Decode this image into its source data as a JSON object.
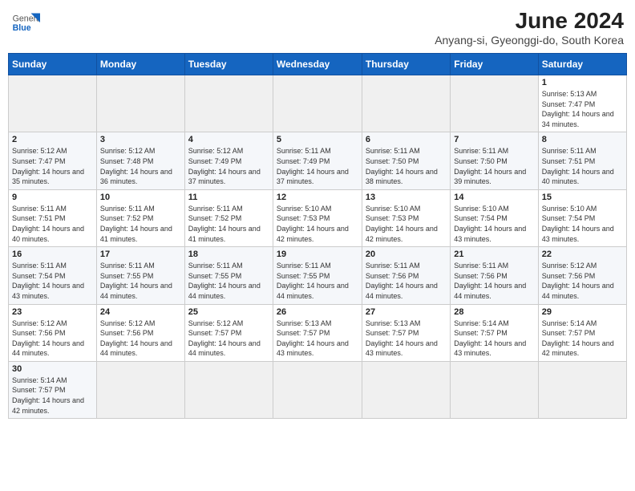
{
  "header": {
    "logo_general": "General",
    "logo_blue": "Blue",
    "month_title": "June 2024",
    "subtitle": "Anyang-si, Gyeonggi-do, South Korea"
  },
  "weekdays": [
    "Sunday",
    "Monday",
    "Tuesday",
    "Wednesday",
    "Thursday",
    "Friday",
    "Saturday"
  ],
  "weeks": [
    [
      {
        "day": "",
        "sunrise": "",
        "sunset": "",
        "daylight": ""
      },
      {
        "day": "",
        "sunrise": "",
        "sunset": "",
        "daylight": ""
      },
      {
        "day": "",
        "sunrise": "",
        "sunset": "",
        "daylight": ""
      },
      {
        "day": "",
        "sunrise": "",
        "sunset": "",
        "daylight": ""
      },
      {
        "day": "",
        "sunrise": "",
        "sunset": "",
        "daylight": ""
      },
      {
        "day": "",
        "sunrise": "",
        "sunset": "",
        "daylight": ""
      },
      {
        "day": "1",
        "sunrise": "Sunrise: 5:13 AM",
        "sunset": "Sunset: 7:47 PM",
        "daylight": "Daylight: 14 hours and 34 minutes."
      }
    ],
    [
      {
        "day": "2",
        "sunrise": "Sunrise: 5:12 AM",
        "sunset": "Sunset: 7:47 PM",
        "daylight": "Daylight: 14 hours and 35 minutes."
      },
      {
        "day": "3",
        "sunrise": "Sunrise: 5:12 AM",
        "sunset": "Sunset: 7:48 PM",
        "daylight": "Daylight: 14 hours and 36 minutes."
      },
      {
        "day": "4",
        "sunrise": "Sunrise: 5:12 AM",
        "sunset": "Sunset: 7:49 PM",
        "daylight": "Daylight: 14 hours and 37 minutes."
      },
      {
        "day": "5",
        "sunrise": "Sunrise: 5:11 AM",
        "sunset": "Sunset: 7:49 PM",
        "daylight": "Daylight: 14 hours and 37 minutes."
      },
      {
        "day": "6",
        "sunrise": "Sunrise: 5:11 AM",
        "sunset": "Sunset: 7:50 PM",
        "daylight": "Daylight: 14 hours and 38 minutes."
      },
      {
        "day": "7",
        "sunrise": "Sunrise: 5:11 AM",
        "sunset": "Sunset: 7:50 PM",
        "daylight": "Daylight: 14 hours and 39 minutes."
      },
      {
        "day": "8",
        "sunrise": "Sunrise: 5:11 AM",
        "sunset": "Sunset: 7:51 PM",
        "daylight": "Daylight: 14 hours and 40 minutes."
      }
    ],
    [
      {
        "day": "9",
        "sunrise": "Sunrise: 5:11 AM",
        "sunset": "Sunset: 7:51 PM",
        "daylight": "Daylight: 14 hours and 40 minutes."
      },
      {
        "day": "10",
        "sunrise": "Sunrise: 5:11 AM",
        "sunset": "Sunset: 7:52 PM",
        "daylight": "Daylight: 14 hours and 41 minutes."
      },
      {
        "day": "11",
        "sunrise": "Sunrise: 5:11 AM",
        "sunset": "Sunset: 7:52 PM",
        "daylight": "Daylight: 14 hours and 41 minutes."
      },
      {
        "day": "12",
        "sunrise": "Sunrise: 5:10 AM",
        "sunset": "Sunset: 7:53 PM",
        "daylight": "Daylight: 14 hours and 42 minutes."
      },
      {
        "day": "13",
        "sunrise": "Sunrise: 5:10 AM",
        "sunset": "Sunset: 7:53 PM",
        "daylight": "Daylight: 14 hours and 42 minutes."
      },
      {
        "day": "14",
        "sunrise": "Sunrise: 5:10 AM",
        "sunset": "Sunset: 7:54 PM",
        "daylight": "Daylight: 14 hours and 43 minutes."
      },
      {
        "day": "15",
        "sunrise": "Sunrise: 5:10 AM",
        "sunset": "Sunset: 7:54 PM",
        "daylight": "Daylight: 14 hours and 43 minutes."
      }
    ],
    [
      {
        "day": "16",
        "sunrise": "Sunrise: 5:11 AM",
        "sunset": "Sunset: 7:54 PM",
        "daylight": "Daylight: 14 hours and 43 minutes."
      },
      {
        "day": "17",
        "sunrise": "Sunrise: 5:11 AM",
        "sunset": "Sunset: 7:55 PM",
        "daylight": "Daylight: 14 hours and 44 minutes."
      },
      {
        "day": "18",
        "sunrise": "Sunrise: 5:11 AM",
        "sunset": "Sunset: 7:55 PM",
        "daylight": "Daylight: 14 hours and 44 minutes."
      },
      {
        "day": "19",
        "sunrise": "Sunrise: 5:11 AM",
        "sunset": "Sunset: 7:55 PM",
        "daylight": "Daylight: 14 hours and 44 minutes."
      },
      {
        "day": "20",
        "sunrise": "Sunrise: 5:11 AM",
        "sunset": "Sunset: 7:56 PM",
        "daylight": "Daylight: 14 hours and 44 minutes."
      },
      {
        "day": "21",
        "sunrise": "Sunrise: 5:11 AM",
        "sunset": "Sunset: 7:56 PM",
        "daylight": "Daylight: 14 hours and 44 minutes."
      },
      {
        "day": "22",
        "sunrise": "Sunrise: 5:12 AM",
        "sunset": "Sunset: 7:56 PM",
        "daylight": "Daylight: 14 hours and 44 minutes."
      }
    ],
    [
      {
        "day": "23",
        "sunrise": "Sunrise: 5:12 AM",
        "sunset": "Sunset: 7:56 PM",
        "daylight": "Daylight: 14 hours and 44 minutes."
      },
      {
        "day": "24",
        "sunrise": "Sunrise: 5:12 AM",
        "sunset": "Sunset: 7:56 PM",
        "daylight": "Daylight: 14 hours and 44 minutes."
      },
      {
        "day": "25",
        "sunrise": "Sunrise: 5:12 AM",
        "sunset": "Sunset: 7:57 PM",
        "daylight": "Daylight: 14 hours and 44 minutes."
      },
      {
        "day": "26",
        "sunrise": "Sunrise: 5:13 AM",
        "sunset": "Sunset: 7:57 PM",
        "daylight": "Daylight: 14 hours and 43 minutes."
      },
      {
        "day": "27",
        "sunrise": "Sunrise: 5:13 AM",
        "sunset": "Sunset: 7:57 PM",
        "daylight": "Daylight: 14 hours and 43 minutes."
      },
      {
        "day": "28",
        "sunrise": "Sunrise: 5:14 AM",
        "sunset": "Sunset: 7:57 PM",
        "daylight": "Daylight: 14 hours and 43 minutes."
      },
      {
        "day": "29",
        "sunrise": "Sunrise: 5:14 AM",
        "sunset": "Sunset: 7:57 PM",
        "daylight": "Daylight: 14 hours and 42 minutes."
      }
    ],
    [
      {
        "day": "30",
        "sunrise": "Sunrise: 5:14 AM",
        "sunset": "Sunset: 7:57 PM",
        "daylight": "Daylight: 14 hours and 42 minutes."
      },
      {
        "day": "",
        "sunrise": "",
        "sunset": "",
        "daylight": ""
      },
      {
        "day": "",
        "sunrise": "",
        "sunset": "",
        "daylight": ""
      },
      {
        "day": "",
        "sunrise": "",
        "sunset": "",
        "daylight": ""
      },
      {
        "day": "",
        "sunrise": "",
        "sunset": "",
        "daylight": ""
      },
      {
        "day": "",
        "sunrise": "",
        "sunset": "",
        "daylight": ""
      },
      {
        "day": "",
        "sunrise": "",
        "sunset": "",
        "daylight": ""
      }
    ]
  ]
}
